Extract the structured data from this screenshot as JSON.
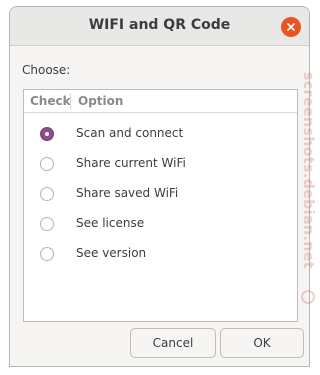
{
  "window": {
    "title": "WIFI and QR Code"
  },
  "body": {
    "choose_label": "Choose:"
  },
  "list": {
    "columns": [
      "Check",
      "Option"
    ],
    "rows": [
      {
        "label": "Scan and connect",
        "checked": true
      },
      {
        "label": "Share current WiFi",
        "checked": false
      },
      {
        "label": "Share saved WiFi",
        "checked": false
      },
      {
        "label": "See license",
        "checked": false
      },
      {
        "label": "See version",
        "checked": false
      }
    ]
  },
  "buttons": {
    "cancel": "Cancel",
    "ok": "OK"
  },
  "watermark": {
    "text": "screenshots.debian.net"
  },
  "colors": {
    "accent": "#8e4c8a",
    "close_button": "#e95420"
  },
  "icons": {
    "close": "close-icon",
    "watermark_logo": "debian-logo-icon"
  }
}
